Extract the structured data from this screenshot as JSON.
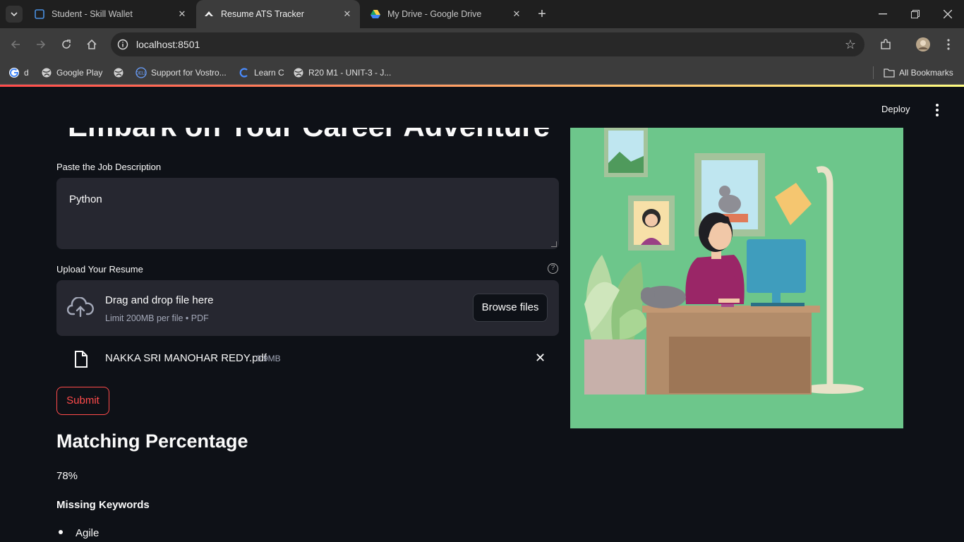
{
  "browser": {
    "tabs": [
      {
        "title": "Student - Skill Wallet",
        "active": false
      },
      {
        "title": "Resume ATS Tracker",
        "active": true
      },
      {
        "title": "My Drive - Google Drive",
        "active": false
      }
    ],
    "new_tab_label": "+",
    "url": "localhost:8501",
    "bookmarks": [
      {
        "label": "d",
        "icon": "google-icon"
      },
      {
        "label": "Google Play",
        "icon": "globe-icon"
      },
      {
        "label": "",
        "icon": "globe-icon"
      },
      {
        "label": "Support for Vostro...",
        "icon": "dell-icon"
      },
      {
        "label": "Learn C",
        "icon": "c-icon"
      },
      {
        "label": "R20 M1 - UNIT-3 - J...",
        "icon": "globe-icon"
      }
    ],
    "all_bookmarks": "All Bookmarks"
  },
  "app": {
    "deploy_label": "Deploy",
    "hero_title": "Embark on Your Career Adventure",
    "job_desc_label": "Paste the Job Description",
    "job_desc_value": "Python",
    "upload_label": "Upload Your Resume",
    "dropzone": {
      "main": "Drag and drop file here",
      "sub": "Limit 200MB per file • PDF",
      "browse": "Browse files"
    },
    "uploaded_file": {
      "name": "NAKKA SRI MANOHAR REDY.pdf",
      "size": "0.9MB"
    },
    "submit_label": "Submit",
    "matching_heading": "Matching Percentage",
    "matching_value": "78%",
    "missing_heading": "Missing Keywords",
    "missing_keywords": [
      "Agile"
    ]
  },
  "colors": {
    "accent": "#ff4b4b",
    "background": "#0e1117",
    "input_bg": "#262730",
    "illustration_bg": "#6dc68b"
  }
}
